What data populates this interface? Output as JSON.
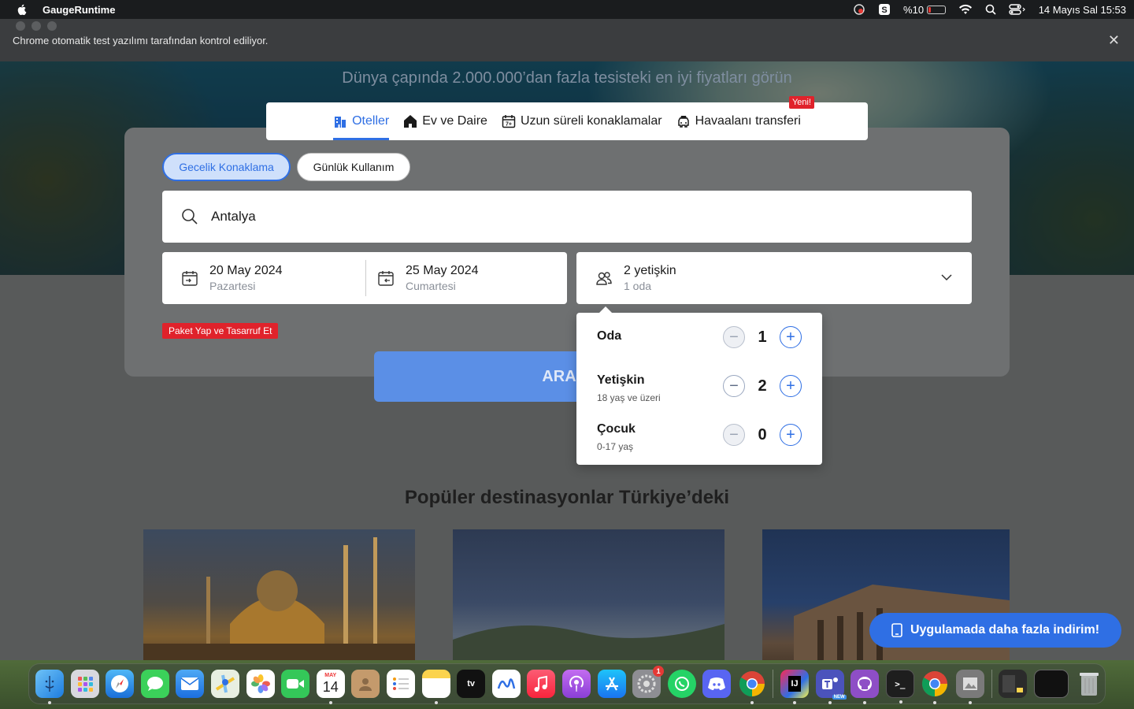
{
  "menubar": {
    "app_name": "GaugeRuntime",
    "battery": "%10",
    "datetime": "14 Mayıs Sal  15:53"
  },
  "browser": {
    "infobar_text": "Chrome otomatik test yazılımı tarafından kontrol ediliyor.",
    "close_symbol": "✕"
  },
  "hero": {
    "subtitle": "Dünya çapında 2.000.000’dan fazla tesisteki en iyi fiyatları görün"
  },
  "tabs": [
    {
      "label": "Oteller",
      "icon": "hotel-icon",
      "active": true
    },
    {
      "label": "Ev ve Daire",
      "icon": "house-icon",
      "active": false
    },
    {
      "label": "Uzun süreli konaklamalar",
      "icon": "calendar-icon",
      "active": false
    },
    {
      "label": "Havaalanı transferi",
      "icon": "car-icon",
      "active": false,
      "badge": "Yeni!"
    }
  ],
  "stay_type": {
    "overnight": "Gecelik Konaklama",
    "day_use": "Günlük Kullanım"
  },
  "search": {
    "destination": "Antalya",
    "checkin_date": "20 May 2024",
    "checkin_day": "Pazartesi",
    "checkout_date": "25 May 2024",
    "checkout_day": "Cumartesi",
    "guests_main": "2 yetişkin",
    "guests_sub": "1 oda",
    "promo": "Paket Yap ve Tasarruf Et",
    "button_visible_text": "ARA"
  },
  "occupancy": {
    "rooms": {
      "label": "Oda",
      "value": "1"
    },
    "adults": {
      "label": "Yetişkin",
      "sub": "18 yaş ve üzeri",
      "value": "2"
    },
    "children": {
      "label": "Çocuk",
      "sub": "0-17 yaş",
      "value": "0"
    }
  },
  "popular": {
    "title": "Popüler destinasyonlar Türkiye’deki"
  },
  "app_banner": "Uygulamada daha fazla indirim!",
  "dock": {
    "calendar_month": "MAY",
    "calendar_day": "14",
    "settings_badge": "1",
    "teams_badge": "NEW"
  },
  "colors": {
    "accent": "#2f6fe4",
    "promo_red": "#e0222b"
  }
}
